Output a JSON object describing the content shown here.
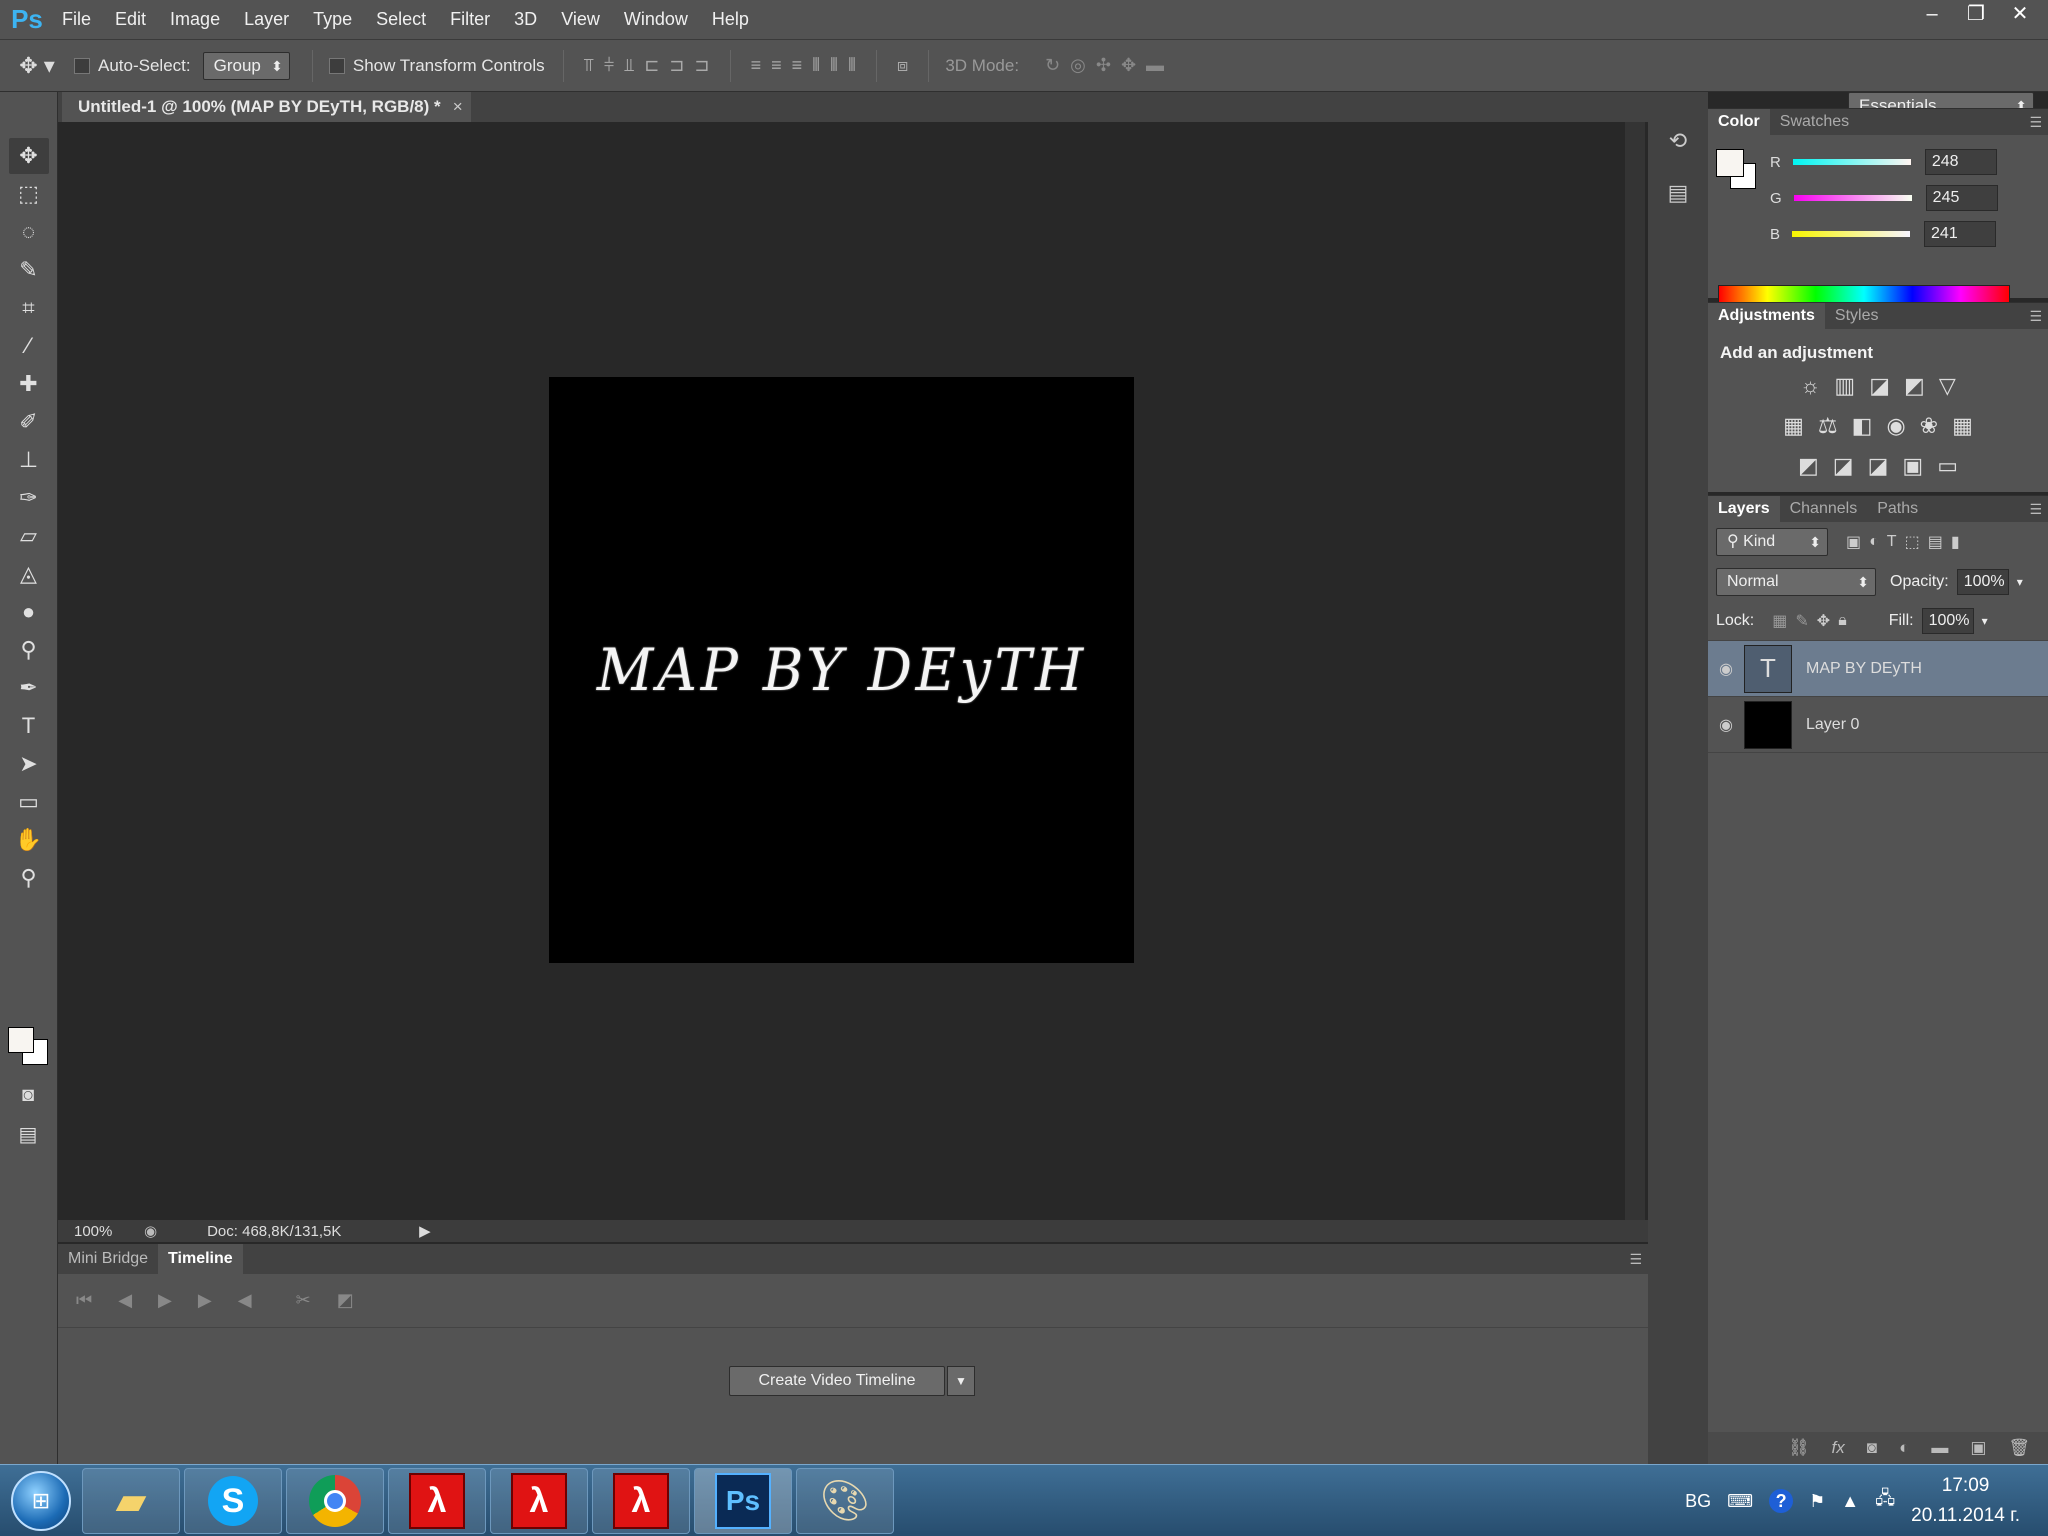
{
  "app": {
    "logo": "Ps",
    "menu": [
      "File",
      "Edit",
      "Image",
      "Layer",
      "Type",
      "Select",
      "Filter",
      "3D",
      "View",
      "Window",
      "Help"
    ],
    "window_controls": [
      "–",
      "❐",
      "✕"
    ]
  },
  "options_bar": {
    "auto_select_label": "Auto-Select:",
    "auto_select_value": "Group",
    "show_transform_label": "Show Transform Controls",
    "mode_3d_label": "3D Mode:",
    "workspace": "Essentials"
  },
  "document": {
    "tab_title": "Untitled-1 @ 100% (MAP BY DEyTH, RGB/8) *",
    "canvas_text": "MAP BY DEyTH",
    "zoom": "100%",
    "doc_info": "Doc: 468,8K/131,5K"
  },
  "bottom_panel": {
    "tabs": [
      "Mini Bridge",
      "Timeline"
    ],
    "active_tab": "Timeline",
    "create_button": "Create Video Timeline"
  },
  "color_panel": {
    "tabs": [
      "Color",
      "Swatches"
    ],
    "r_label": "R",
    "g_label": "G",
    "b_label": "B",
    "r": "248",
    "g": "245",
    "b": "241"
  },
  "adjustments_panel": {
    "tabs": [
      "Adjustments",
      "Styles"
    ],
    "title": "Add an adjustment"
  },
  "layers_panel": {
    "tabs": [
      "Layers",
      "Channels",
      "Paths"
    ],
    "kind": "Kind",
    "blend_mode": "Normal",
    "opacity_label": "Opacity:",
    "opacity": "100%",
    "lock_label": "Lock:",
    "fill_label": "Fill:",
    "fill": "100%",
    "layers": [
      {
        "name": "MAP BY DEyTH",
        "type": "text",
        "selected": true
      },
      {
        "name": "Layer 0",
        "type": "fill",
        "selected": false
      }
    ]
  },
  "taskbar": {
    "language": "BG",
    "time": "17:09",
    "date": "20.11.2014 г."
  },
  "colors": {
    "foreground": "#f8f5f1",
    "selected_layer": "#6c7c8f",
    "ps_blue": "#3db4f2"
  }
}
